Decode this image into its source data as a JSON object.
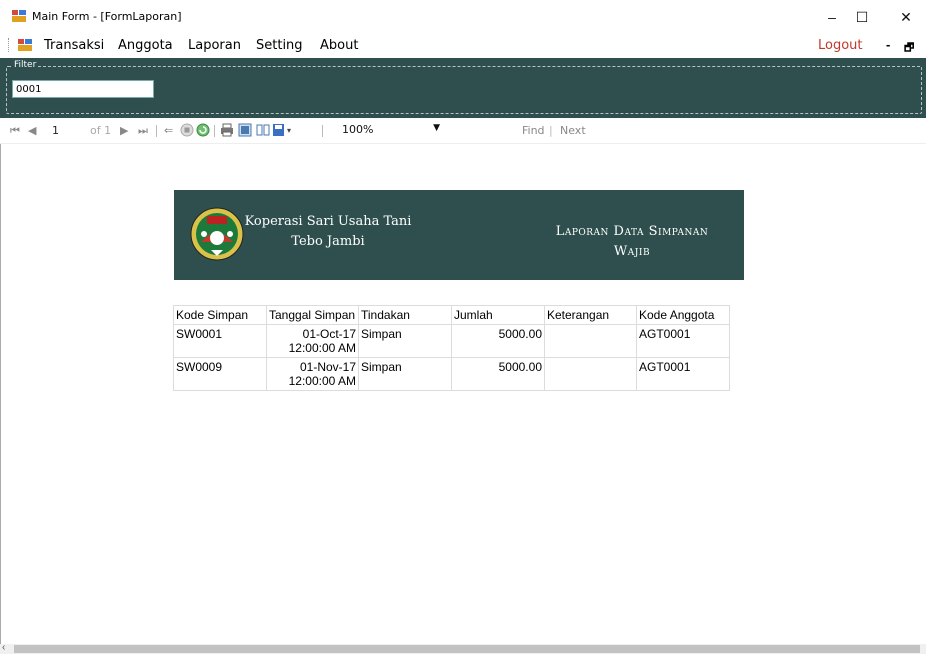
{
  "window": {
    "title": "Main Form - [FormLaporan]",
    "controls": {
      "minimize": "–",
      "maximize": "☐",
      "close": "✕"
    }
  },
  "menu": {
    "items": [
      "Transaksi",
      "Anggota",
      "Laporan",
      "Setting",
      "About"
    ],
    "logout": "Logout",
    "mdi_minimize": "-",
    "mdi_restore": "🗗"
  },
  "filter": {
    "legend": "Filter",
    "value": "0001"
  },
  "toolbar": {
    "page_current": "1",
    "page_of": "of 1",
    "zoom": "100%",
    "find": "Find",
    "separator": "|",
    "next": "Next"
  },
  "report": {
    "org_line1": "Koperasi Sari Usaha Tani",
    "org_line2": "Tebo Jambi",
    "title_line1": "Laporan Data Simpanan",
    "title_line2": "Wajib",
    "columns": [
      "Kode Simpan",
      "Tanggal Simpan",
      "Tindakan",
      "Jumlah",
      "Keterangan",
      "Kode Anggota"
    ],
    "rows": [
      {
        "kode": "SW0001",
        "tgl_date": "01-Oct-17",
        "tgl_time": "12:00:00 AM",
        "tindakan": "Simpan",
        "jumlah": "5000.00",
        "keterangan": "",
        "anggota": "AGT0001"
      },
      {
        "kode": "SW0009",
        "tgl_date": "01-Nov-17",
        "tgl_time": "12:00:00 AM",
        "tindakan": "Simpan",
        "jumlah": "5000.00",
        "keterangan": "",
        "anggota": "AGT0001"
      }
    ]
  },
  "colors": {
    "banner": "#2f4f4f",
    "logout": "#c0392b"
  }
}
